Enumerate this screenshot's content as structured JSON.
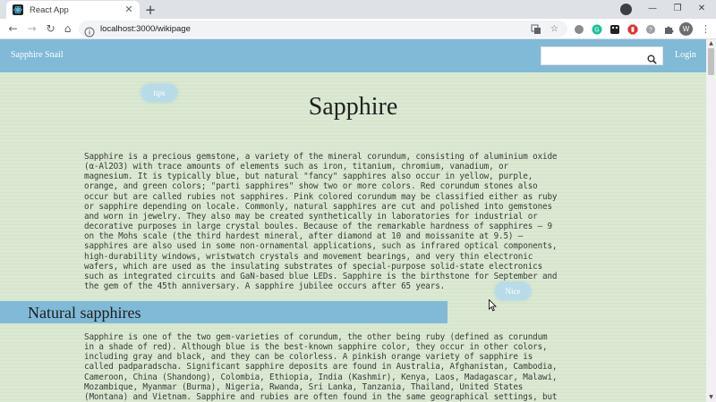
{
  "browser": {
    "tab_title": "React App",
    "tab_close": "✕",
    "new_tab": "+",
    "url": "localhost:3000/wikipage",
    "avatar_initial": "W",
    "window_minimize": "—",
    "window_restore": "❐",
    "window_close": "✕",
    "back": "←",
    "forward": "→",
    "reload": "↻",
    "home": "⌂",
    "menu": "⋮",
    "star": "☆"
  },
  "navbar": {
    "brand": "Sapphire Snail",
    "search_placeholder": "",
    "login_label": "Login"
  },
  "bubbles": {
    "tips": "tips",
    "nice": "Nice"
  },
  "article": {
    "title": "Sapphire",
    "paragraph1": "Sapphire is a precious gemstone, a variety of the mineral corundum, consisting of aluminium oxide\n(α-Al2O3) with trace amounts of elements such as iron, titanium, chromium, vanadium, or\nmagnesium. It is typically blue, but natural \"fancy\" sapphires also occur in yellow, purple,\norange, and green colors; \"parti sapphires\" show two or more colors. Red corundum stones also\noccur but are called rubies not sapphires. Pink colored corundum may be classified either as ruby\nor sapphire depending on locale. Commonly, natural sapphires are cut and polished into gemstones\nand worn in jewelry. They also may be created synthetically in laboratories for industrial or\ndecorative purposes in large crystal boules. Because of the remarkable hardness of sapphires – 9\non the Mohs scale (the third hardest mineral, after diamond at 10 and moissanite at 9.5) –\nsapphires are also used in some non-ornamental applications, such as infrared optical components,\nhigh-durability windows, wristwatch crystals and movement bearings, and very thin electronic\nwafers, which are used as the insulating substrates of special-purpose solid-state electronics\nsuch as integrated circuits and GaN-based blue LEDs. Sapphire is the birthstone for September and\nthe gem of the 45th anniversary. A sapphire jubilee occurs after 65 years.",
    "section1_title": "Natural sapphires",
    "paragraph2": "Sapphire is one of the two gem-varieties of corundum, the other being ruby (defined as corundum\nin a shade of red). Although blue is the best-known sapphire color, they occur in other colors,\nincluding gray and black, and they can be colorless. A pinkish orange variety of sapphire is\ncalled padparadscha. Significant sapphire deposits are found in Australia, Afghanistan, Cambodia,\nCameroon, China (Shandong), Colombia, Ethiopia, India (Kashmir), Kenya, Laos, Madagascar, Malawi,\nMozambique, Myanmar (Burma), Nigeria, Rwanda, Sri Lanka, Tanzania, Thailand, United States\n(Montana) and Vietnam. Sapphire and rubies are often found in the same geographical settings, but"
  },
  "colors": {
    "navbar": "#80bad6",
    "page_background": "#d8e8cf",
    "bubble": "#b7dbe8"
  }
}
